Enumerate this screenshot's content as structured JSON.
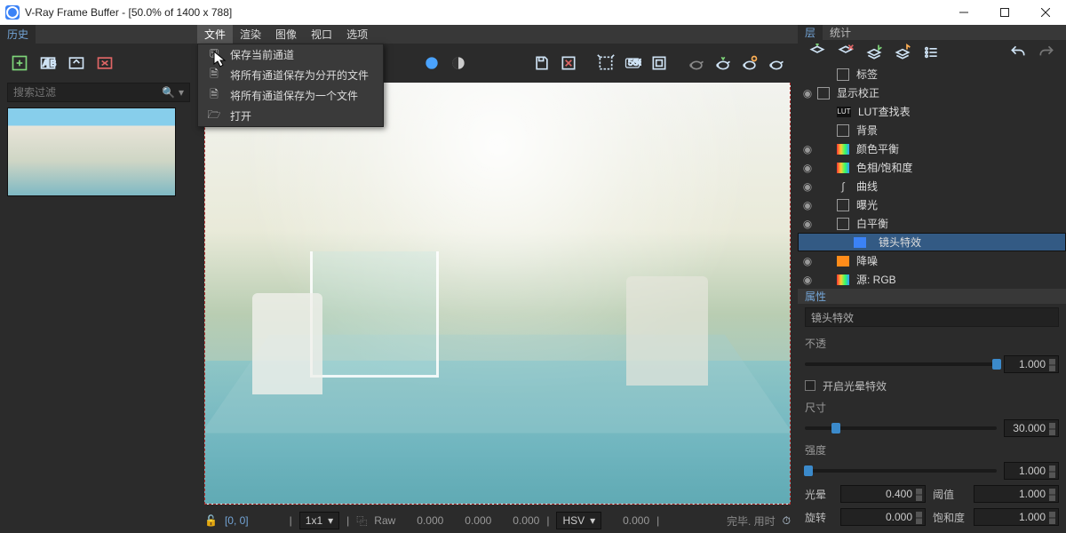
{
  "window": {
    "title": "V-Ray Frame Buffer - [50.0% of 1400 x 788]"
  },
  "history": {
    "header": "历史",
    "search_placeholder": "搜索过滤"
  },
  "menubar": {
    "items": [
      "文件",
      "渲染",
      "图像",
      "视口",
      "选项"
    ],
    "open_index": 0,
    "dropdown": [
      "保存当前通道",
      "将所有通道保存为分开的文件",
      "将所有通道保存为一个文件",
      "打开"
    ]
  },
  "status": {
    "coord": "[0, 0]",
    "grid": "1x1",
    "mode": "Raw",
    "v1": "0.000",
    "v2": "0.000",
    "v3": "0.000",
    "space": "HSV",
    "v4": "0.000",
    "right": "完毕. 用时"
  },
  "right": {
    "tabs": [
      "层",
      "统计"
    ],
    "layers": [
      {
        "eye": "",
        "indent": 1,
        "icon": "box",
        "label": "标签"
      },
      {
        "eye": "◉",
        "indent": 0,
        "icon": "box-check",
        "label": "显示校正"
      },
      {
        "eye": "",
        "indent": 1,
        "icon": "lut",
        "label": "LUT查找表"
      },
      {
        "eye": "",
        "indent": 1,
        "icon": "blank",
        "label": "背景"
      },
      {
        "eye": "◉",
        "indent": 1,
        "icon": "rainbow",
        "label": "颜色平衡"
      },
      {
        "eye": "◉",
        "indent": 1,
        "icon": "rainbow",
        "label": "色相/饱和度"
      },
      {
        "eye": "◉",
        "indent": 1,
        "icon": "curve",
        "label": "曲线"
      },
      {
        "eye": "◉",
        "indent": 1,
        "icon": "box",
        "label": "曝光"
      },
      {
        "eye": "◉",
        "indent": 1,
        "icon": "box",
        "label": "白平衡"
      },
      {
        "eye": "",
        "indent": 1,
        "icon": "blue",
        "label": "镜头特效",
        "selected": true
      },
      {
        "eye": "◉",
        "indent": 1,
        "icon": "orange",
        "label": "降噪"
      },
      {
        "eye": "◉",
        "indent": 1,
        "icon": "rainbow",
        "label": "源: RGB"
      }
    ],
    "props": {
      "header": "属性",
      "title": "镜头特效",
      "opacity_label": "不透",
      "opacity_value": "1.000",
      "glow_checkbox": "开启光晕特效",
      "size_label": "尺寸",
      "size_value": "30.000",
      "intensity_label": "强度",
      "intensity_value": "1.000",
      "bloom_label": "光晕",
      "bloom_value": "0.400",
      "threshold_label": "阈值",
      "threshold_value": "1.000",
      "rotate_label": "旋转",
      "rotate_value": "0.000",
      "saturation_label": "饱和度",
      "saturation_value": "1.000"
    }
  },
  "icons": {
    "lut": "LUT"
  }
}
